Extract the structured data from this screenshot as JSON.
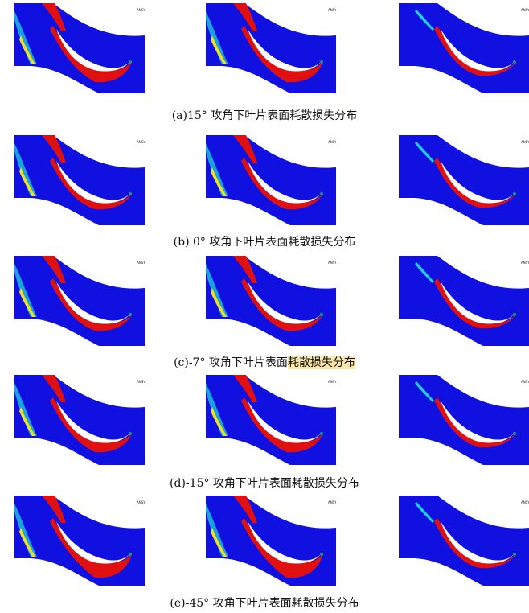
{
  "figure": {
    "panel_logo": "ANSYS",
    "rows": [
      {
        "caption_plain": "(a)15°  攻角下叶片表面耗散损失分布",
        "caption_highlight": ""
      },
      {
        "caption_plain": "(b) 0°  攻角下叶片表面耗散损失分布",
        "caption_highlight": ""
      },
      {
        "caption_plain": "(c)-7°  攻角下叶片表面",
        "caption_highlight": "耗散损失分布"
      },
      {
        "caption_plain": "(d)-15°  攻角下叶片表面耗散损失分布",
        "caption_highlight": ""
      },
      {
        "caption_plain": "(e)-45°  攻角下叶片表面耗散损失分布",
        "caption_highlight": ""
      }
    ],
    "colors": {
      "background": "#1010e0",
      "high": "#e01010",
      "mid": "#20d0e0",
      "low": "#10a060",
      "highlight": "#fde9a6"
    }
  }
}
